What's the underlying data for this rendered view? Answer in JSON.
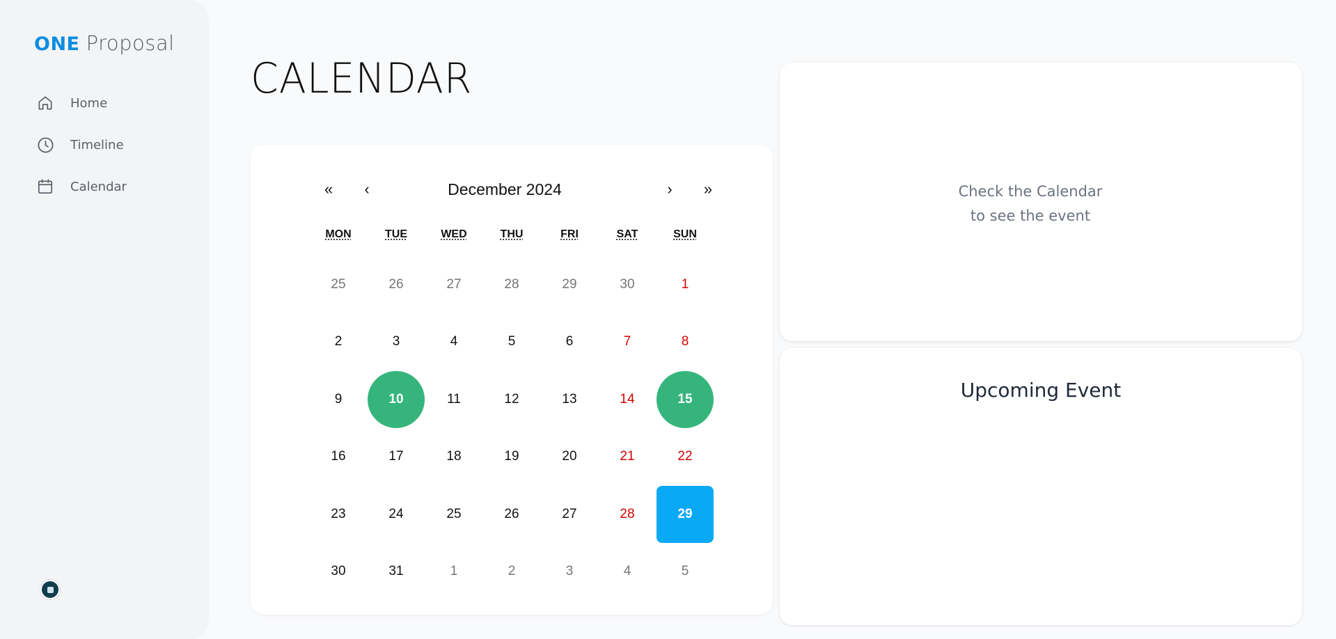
{
  "brand": {
    "one": "ONE",
    "proposal": "Proposal"
  },
  "sidebar": {
    "items": [
      {
        "label": "Home",
        "icon": "home-icon"
      },
      {
        "label": "Timeline",
        "icon": "clock-icon"
      },
      {
        "label": "Calendar",
        "icon": "calendar-icon"
      }
    ]
  },
  "page": {
    "title": "CALENDAR"
  },
  "calendar": {
    "nav": {
      "prev_year": "«",
      "prev_month": "‹",
      "next_month": "›",
      "next_year": "»"
    },
    "month_label": "December 2024",
    "weekdays": [
      {
        "abbr": "MON",
        "full": "Monday"
      },
      {
        "abbr": "TUE",
        "full": "Tuesday"
      },
      {
        "abbr": "WED",
        "full": "Wednesday"
      },
      {
        "abbr": "THU",
        "full": "Thursday"
      },
      {
        "abbr": "FRI",
        "full": "Friday"
      },
      {
        "abbr": "SAT",
        "full": "Saturday"
      },
      {
        "abbr": "SUN",
        "full": "Sunday"
      }
    ],
    "weeks": [
      [
        {
          "d": "25",
          "t": "neighbor"
        },
        {
          "d": "26",
          "t": "neighbor"
        },
        {
          "d": "27",
          "t": "neighbor"
        },
        {
          "d": "28",
          "t": "neighbor"
        },
        {
          "d": "29",
          "t": "neighbor"
        },
        {
          "d": "30",
          "t": "neighbor"
        },
        {
          "d": "1",
          "t": "weekend"
        }
      ],
      [
        {
          "d": "2",
          "t": ""
        },
        {
          "d": "3",
          "t": ""
        },
        {
          "d": "4",
          "t": ""
        },
        {
          "d": "5",
          "t": ""
        },
        {
          "d": "6",
          "t": ""
        },
        {
          "d": "7",
          "t": "weekend"
        },
        {
          "d": "8",
          "t": "weekend"
        }
      ],
      [
        {
          "d": "9",
          "t": ""
        },
        {
          "d": "10",
          "t": "event"
        },
        {
          "d": "11",
          "t": ""
        },
        {
          "d": "12",
          "t": ""
        },
        {
          "d": "13",
          "t": ""
        },
        {
          "d": "14",
          "t": "weekend"
        },
        {
          "d": "15",
          "t": "event"
        }
      ],
      [
        {
          "d": "16",
          "t": ""
        },
        {
          "d": "17",
          "t": ""
        },
        {
          "d": "18",
          "t": ""
        },
        {
          "d": "19",
          "t": ""
        },
        {
          "d": "20",
          "t": ""
        },
        {
          "d": "21",
          "t": "weekend"
        },
        {
          "d": "22",
          "t": "weekend"
        }
      ],
      [
        {
          "d": "23",
          "t": ""
        },
        {
          "d": "24",
          "t": ""
        },
        {
          "d": "25",
          "t": ""
        },
        {
          "d": "26",
          "t": ""
        },
        {
          "d": "27",
          "t": ""
        },
        {
          "d": "28",
          "t": "weekend"
        },
        {
          "d": "29",
          "t": "today"
        }
      ],
      [
        {
          "d": "30",
          "t": ""
        },
        {
          "d": "31",
          "t": ""
        },
        {
          "d": "1",
          "t": "neighbor"
        },
        {
          "d": "2",
          "t": "neighbor"
        },
        {
          "d": "3",
          "t": "neighbor"
        },
        {
          "d": "4",
          "t": "neighbor"
        },
        {
          "d": "5",
          "t": "neighbor"
        }
      ]
    ]
  },
  "event_hint": {
    "line1": "Check the Calendar",
    "line2": "to see the event"
  },
  "upcoming": {
    "title": "Upcoming Event"
  },
  "colors": {
    "brand_blue": "#0b8de0",
    "event_green": "#35b57c",
    "today_blue": "#0aa9f5",
    "weekend_red": "#d10000"
  }
}
